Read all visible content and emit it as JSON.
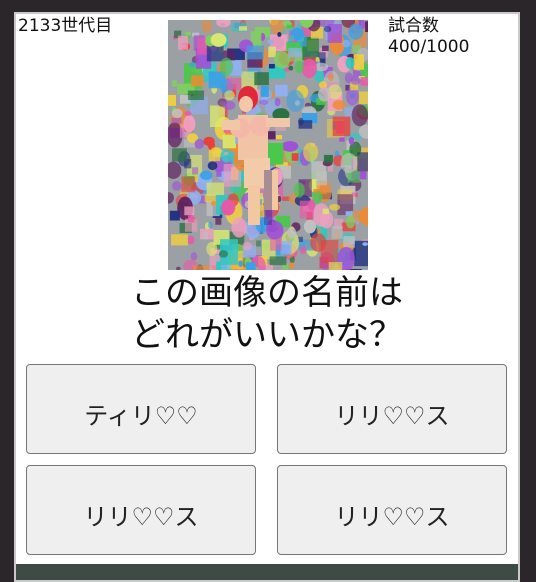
{
  "header": {
    "generation": "2133世代目",
    "trials_label": "試合数",
    "trials_value": "400/1000"
  },
  "artwork": {
    "description_icon": "generated-abstract-figure-image"
  },
  "question": {
    "line1": "この画像の名前は",
    "line2": "どれがいいかな？"
  },
  "choices": [
    {
      "label": "ティリ♡♡"
    },
    {
      "label": "リリ♡♡ス"
    },
    {
      "label": "リリ♡♡ス"
    },
    {
      "label": "リリ♡♡ス"
    }
  ],
  "colors": {
    "page_background": "#2b2629",
    "panel_background": "#ffffff",
    "button_background": "#efefef",
    "footer_bar": "#3e4a44"
  }
}
